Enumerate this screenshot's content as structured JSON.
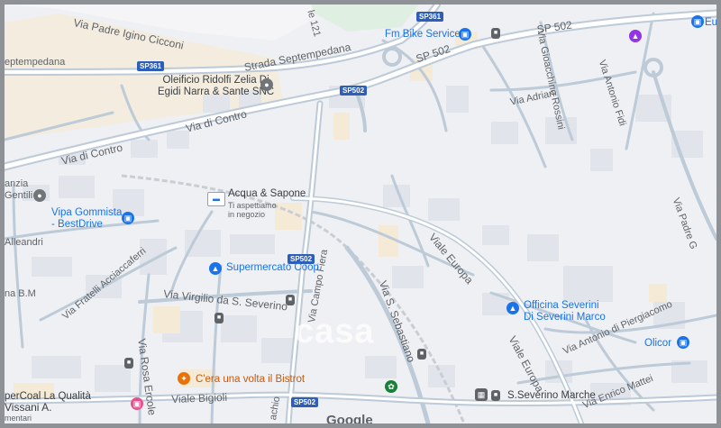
{
  "map": {
    "streets": [
      {
        "id": "padre-igino",
        "text": "Via Padre Igino Cicconi"
      },
      {
        "id": "septempedana",
        "text": "Strada Septempedana"
      },
      {
        "id": "septempedana-left",
        "text": "eptempedana"
      },
      {
        "id": "via-121",
        "text": "le 121"
      },
      {
        "id": "via-di-contro-1",
        "text": "Via di Contro"
      },
      {
        "id": "via-di-contro-2",
        "text": "Via di Contro"
      },
      {
        "id": "sp502-label",
        "text": "SP 502"
      },
      {
        "id": "sp502-label-2",
        "text": "SP 502"
      },
      {
        "id": "gioacchino",
        "text": "Via Gioacchino Rossini"
      },
      {
        "id": "adriani",
        "text": "Via Adriani"
      },
      {
        "id": "antonio-fidi",
        "text": "Via Antonio Fidi"
      },
      {
        "id": "padre-g",
        "text": "Via Padre G"
      },
      {
        "id": "europa-1",
        "text": "Viale Europa"
      },
      {
        "id": "europa-2",
        "text": "Viale Europa"
      },
      {
        "id": "alleandri",
        "text": "Alleandri"
      },
      {
        "id": "acciaccaferri",
        "text": "Via Fratelli Acciaccaferri"
      },
      {
        "id": "virgilio",
        "text": "Via Virgilio da S. Severino"
      },
      {
        "id": "campo-fiera",
        "text": "Via Campo Fiera"
      },
      {
        "id": "sebastiano",
        "text": "Via S. Sebastiano"
      },
      {
        "id": "rosa-ercole",
        "text": "Via Rosa Ercole"
      },
      {
        "id": "bigioli",
        "text": "Viale Bigioli"
      },
      {
        "id": "piergiacomo",
        "text": "Via Antonio di Piergiacomo"
      },
      {
        "id": "enrico-mattei",
        "text": "Via Enrico Mattei"
      },
      {
        "id": "anzia",
        "text": "anzia"
      },
      {
        "id": "gentili",
        "text": "Gentili"
      },
      {
        "id": "na-bm",
        "text": "na B.M"
      },
      {
        "id": "vissani",
        "text": "Vissani A."
      },
      {
        "id": "mentari",
        "text": "mentari"
      },
      {
        "id": "achio",
        "text": "achio"
      }
    ],
    "route_badges": [
      "SP361",
      "SP361",
      "SP502",
      "SP502",
      "SP502"
    ],
    "pois": {
      "fm_bike": "Fm Bike Service",
      "oleificio_1": "Oleificio Ridolfi Zelia Di",
      "oleificio_2": "Egidi Narra & Sante SNC",
      "acqua_sapone": "Acqua & Sapone",
      "acqua_sub_1": "Ti aspettiamo",
      "acqua_sub_2": "in negozio",
      "vipa_1": "Vipa Gommista",
      "vipa_2": "- BestDrive",
      "supermercato": "Supermercato Coop",
      "officina_1": "Officina Severini",
      "officina_2": "Di Severini Marco",
      "olicor": "Olicor",
      "cera_una_volta": "C'era una volta il Bistrot",
      "supercoal": "perCoal La Qualità",
      "station": "S.Severino Marche",
      "eu": "Eu"
    },
    "watermark": "casa",
    "google": "Google"
  }
}
